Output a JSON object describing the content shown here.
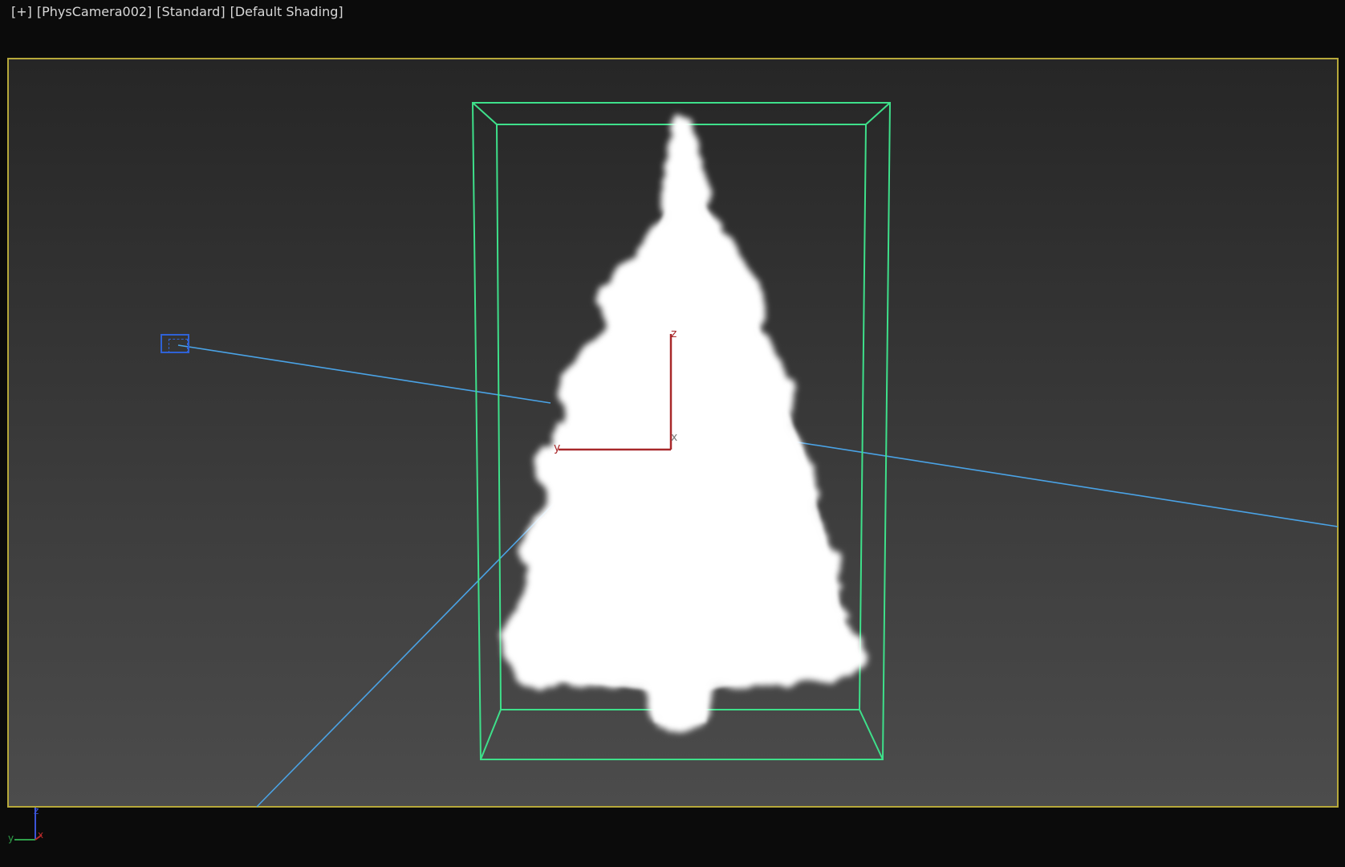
{
  "viewport": {
    "labels": [
      "[+]",
      "[PhysCamera002]",
      "[Standard]",
      "[Default Shading]"
    ]
  },
  "gizmo": {
    "z_label": "z",
    "x_label": "x",
    "y_label": "y"
  },
  "axis_tripod": {
    "z_label": "z",
    "x_label": "x",
    "y_label": "y"
  },
  "colors": {
    "safe_frame": "#b6a83a",
    "bounding_box": "#3ee08a",
    "camera_target_line": "#4aa3e6",
    "camera_icon": "#2f62d6",
    "gizmo_axis": "#a8282a",
    "tree_volume": "#ffffff"
  }
}
